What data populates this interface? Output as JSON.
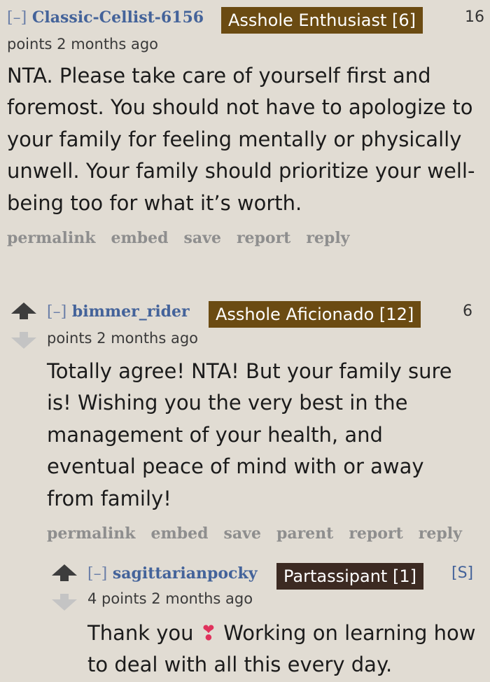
{
  "comment1": {
    "toggle": "[–]",
    "author": "Classic-Cellist-6156",
    "flair": "Asshole Enthusiast [6]",
    "score_num": "16",
    "meta": "points 2 months ago",
    "body": "NTA. Please take care of yourself first and foremost. You should not have to apologize to your family for feeling mentally or physically unwell. Your family should prioritize your well-being too for what it’s worth.",
    "actions": [
      "permalink",
      "embed",
      "save",
      "report",
      "reply"
    ]
  },
  "comment2": {
    "toggle": "[–]",
    "author": "bimmer_rider",
    "flair": "Asshole Aficionado [12]",
    "score_num": "6",
    "meta": "points 2 months ago",
    "body": "Totally agree! NTA! But your family sure is! Wishing you the very best in the management of your health, and eventual peace of mind with or away from family!",
    "actions": [
      "permalink",
      "embed",
      "save",
      "parent",
      "report",
      "reply"
    ]
  },
  "comment3": {
    "toggle": "[–]",
    "author": "sagittarianpocky",
    "flair": "Partassipant [1]",
    "submitter_tag": "[S]",
    "meta": "4 points 2 months ago",
    "body_start": "Thank you",
    "emoji": "❣",
    "body_end": "Working on learning how to deal with all this every day."
  },
  "colors": {
    "background": "#e1dcd3",
    "flair_brown": "#6b4b12",
    "flair_dark": "#3c2a22",
    "author_blue": "#44639a",
    "actions_gray": "#8e8e8e"
  },
  "icons": [
    "upvote-icon",
    "downvote-icon"
  ]
}
